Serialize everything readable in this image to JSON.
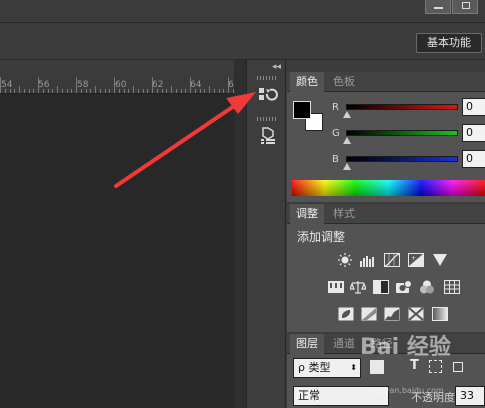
{
  "workspace_label": "基本功能",
  "ruler": {
    "ticks": [
      "54",
      "56",
      "58",
      "60",
      "62",
      "64",
      "6"
    ]
  },
  "color_panel": {
    "tabs": [
      "颜色",
      "色板"
    ],
    "channels": [
      {
        "label": "R",
        "value": "0",
        "color": "#e01414"
      },
      {
        "label": "G",
        "value": "0",
        "color": "#18c418"
      },
      {
        "label": "B",
        "value": "0",
        "color": "#1a2fe0"
      }
    ],
    "foreground": "#000000",
    "background": "#ffffff"
  },
  "adjustments_panel": {
    "tabs": [
      "调整",
      "样式"
    ],
    "heading": "添加调整",
    "icons_row1": [
      "brightness-icon",
      "levels-icon",
      "curves-icon",
      "exposure-icon",
      "vibrance-icon"
    ],
    "icons_row2": [
      "hue-saturation-icon",
      "color-balance-icon",
      "black-white-icon",
      "photo-filter-icon",
      "channel-mixer-icon",
      "color-lookup-icon"
    ],
    "icons_row3": [
      "invert-icon",
      "posterize-icon",
      "threshold-icon",
      "selective-color-icon",
      "gradient-map-icon"
    ]
  },
  "layers_panel": {
    "tabs": [
      "图层",
      "通道",
      "路径"
    ],
    "filter_label": "ρ 类型",
    "blend_mode": "正常",
    "opacity_label": "不透明度:",
    "opacity_value": "33"
  },
  "watermark": {
    "text": "Bai 经验",
    "sub": "jingyan.baidu.com"
  },
  "annotation_color": "#f03a3a"
}
